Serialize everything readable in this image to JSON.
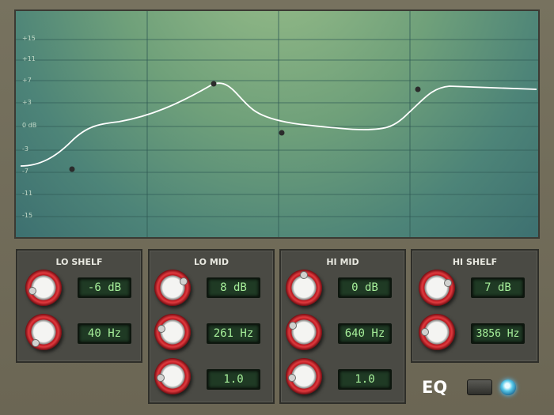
{
  "graph": {
    "y_labels": [
      "+15",
      "+11",
      "+7",
      "+3",
      "0 dB",
      "-3",
      "-7",
      "-11",
      "-15"
    ]
  },
  "bands": {
    "lo_shelf": {
      "title": "LO SHELF",
      "gain": "-6 dB",
      "freq": "40 Hz"
    },
    "lo_mid": {
      "title": "LO MID",
      "gain": "8 dB",
      "freq": "261 Hz",
      "q": "1.0"
    },
    "hi_mid": {
      "title": "HI MID",
      "gain": "0 dB",
      "freq": "640 Hz",
      "q": "1.0"
    },
    "hi_shelf": {
      "title": "HI SHELF",
      "gain": "7 dB",
      "freq": "3856 Hz"
    }
  },
  "footer": {
    "eq_label": "EQ"
  },
  "colors": {
    "knob_ring": "#c0202a",
    "readout_text": "#a6ef9a",
    "led": "#58c8e8"
  }
}
